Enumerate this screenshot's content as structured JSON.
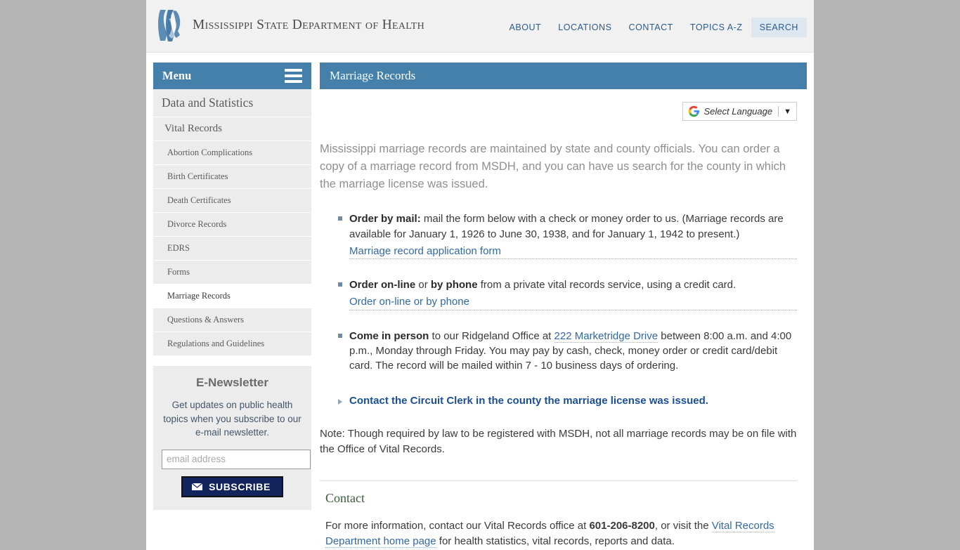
{
  "site": {
    "name": "Mississippi State Department of Health",
    "logo_icon": "mississippi-state-outline-logo"
  },
  "topnav": {
    "items": [
      {
        "label": "ABOUT",
        "active": false
      },
      {
        "label": "LOCATIONS",
        "active": false
      },
      {
        "label": "CONTACT",
        "active": false
      },
      {
        "label": "TOPICS A-Z",
        "active": false
      },
      {
        "label": "SEARCH",
        "active": true
      }
    ]
  },
  "sidebar": {
    "menu_title": "Menu",
    "menu_icon": "hamburger-icon",
    "items": [
      {
        "label": "Data and Statistics",
        "level": 0,
        "active": false
      },
      {
        "label": "Vital Records",
        "level": 1,
        "active": false
      },
      {
        "label": "Abortion Complications",
        "level": 2,
        "active": false
      },
      {
        "label": "Birth Certificates",
        "level": 2,
        "active": false
      },
      {
        "label": "Death Certificates",
        "level": 2,
        "active": false
      },
      {
        "label": "Divorce Records",
        "level": 2,
        "active": false
      },
      {
        "label": "EDRS",
        "level": 2,
        "active": false
      },
      {
        "label": "Forms",
        "level": 2,
        "active": false
      },
      {
        "label": "Marriage Records",
        "level": 2,
        "active": true
      },
      {
        "label": "Questions & Answers",
        "level": 2,
        "active": false
      },
      {
        "label": "Regulations and Guidelines",
        "level": 2,
        "active": false
      }
    ],
    "newsletter": {
      "title": "E-Newsletter",
      "copy": "Get updates on public health topics when you subscribe to our e-mail newsletter.",
      "input_placeholder": "email address",
      "input_value": "",
      "button_label": "SUBSCRIBE",
      "button_icon": "envelope-icon"
    }
  },
  "main": {
    "page_title": "Marriage Records",
    "translate": {
      "icon": "google-g-icon",
      "label": "Select Language",
      "caret": "▼"
    },
    "intro": "Mississippi marriage records are maintained by state and county officials. You can order a copy of a marriage record from MSDH, and you can have us search for the county in which the marriage license was issued.",
    "bullets": [
      {
        "lead": "Order by mail:",
        "lead2": "",
        "mid": "",
        "text": " mail the form below with a check or money order to us. (Marriage records are available for January 1, 1926 to June 30, 1938, and for January 1, 1942 to present.)",
        "link": "Marriage record application form"
      },
      {
        "lead": "Order on-line",
        "mid": " or ",
        "lead2": "by phone",
        "text": " from a private vital records service, using a credit card.",
        "link": "Order on-line or by phone"
      },
      {
        "lead": "Come in person",
        "lead2": "",
        "mid": "",
        "text_before": " to our Ridgeland Office at ",
        "inline_link": "222 Marketridge Drive",
        "text_after": " between 8:00 a.m. and 4:00 p.m., Monday through Friday. You may pay by cash, check, money order or credit card/debit card. The record will be mailed within 7 - 10 business days of ordering.",
        "link": ""
      }
    ],
    "clerk_link": "Contact the Circuit Clerk in the county the marriage license was issued.",
    "note": "Note: Though required by law to be registered with MSDH, not all marriage records may be on file with the Office of Vital Records.",
    "contact": {
      "heading": "Contact",
      "text_before": "For more information, contact our Vital Records office at ",
      "phone": "601-206-8200",
      "text_mid": ", or visit the ",
      "link": "Vital Records Department home page",
      "text_after": " for health statistics, vital records, reports and data."
    }
  },
  "colors": {
    "accent_blue": "#4480aa",
    "link_blue": "#3169a5",
    "clerk_blue": "#1a4f96",
    "subscribe_navy": "#11245c",
    "heading_green": "#3b5c3b",
    "page_bg": "#b4b4b4"
  }
}
